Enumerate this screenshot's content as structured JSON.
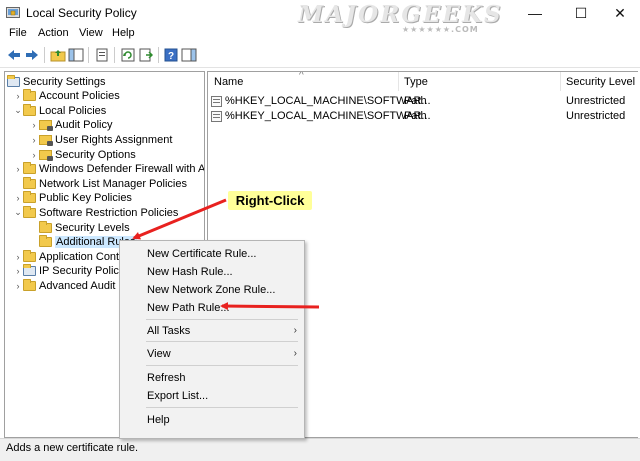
{
  "window": {
    "title": "Local Security Policy",
    "controls": {
      "minimize": "—",
      "maximize": "☐",
      "close": "✕"
    }
  },
  "watermark": {
    "brand": "MAJORGEEKS",
    "sub": "★★★★★★.COM"
  },
  "menu": [
    "File",
    "Action",
    "View",
    "Help"
  ],
  "toolbar": {
    "icons": [
      "back-arrow-icon",
      "forward-arrow-icon",
      "up-folder-icon",
      "show-hide-tree-icon",
      "properties-icon",
      "refresh-icon",
      "export-list-icon",
      "help-icon",
      "show-action-pane-icon"
    ]
  },
  "tree": [
    {
      "label": "Security Settings",
      "indent": 0,
      "chevron": "",
      "icon": "security-settings-icon"
    },
    {
      "label": "Account Policies",
      "indent": 1,
      "chevron": "›",
      "icon": "folder-icon"
    },
    {
      "label": "Local Policies",
      "indent": 1,
      "chevron": "⌄",
      "icon": "folder-icon"
    },
    {
      "label": "Audit Policy",
      "indent": 2,
      "chevron": "›",
      "icon": "lock-folder-icon"
    },
    {
      "label": "User Rights Assignment",
      "indent": 2,
      "chevron": "›",
      "icon": "lock-folder-icon"
    },
    {
      "label": "Security Options",
      "indent": 2,
      "chevron": "›",
      "icon": "lock-folder-icon"
    },
    {
      "label": "Windows Defender Firewall with Adva",
      "indent": 1,
      "chevron": "›",
      "icon": "folder-icon"
    },
    {
      "label": "Network List Manager Policies",
      "indent": 1,
      "chevron": "",
      "icon": "folder-icon"
    },
    {
      "label": "Public Key Policies",
      "indent": 1,
      "chevron": "›",
      "icon": "folder-icon"
    },
    {
      "label": "Software Restriction Policies",
      "indent": 1,
      "chevron": "⌄",
      "icon": "folder-icon"
    },
    {
      "label": "Security Levels",
      "indent": 2,
      "chevron": "",
      "icon": "folder-icon"
    },
    {
      "label": "Additional Rules",
      "indent": 2,
      "chevron": "",
      "icon": "folder-icon",
      "selected": true
    },
    {
      "label": "Application Contro",
      "indent": 1,
      "chevron": "›",
      "icon": "folder-icon"
    },
    {
      "label": "IP Security Policie",
      "indent": 1,
      "chevron": "›",
      "icon": "ip-security-icon"
    },
    {
      "label": "Advanced Audit P",
      "indent": 1,
      "chevron": "›",
      "icon": "folder-icon"
    }
  ],
  "list": {
    "columns": [
      "Name",
      "Type",
      "Security Level"
    ],
    "sort_indicator": "^",
    "rows": [
      {
        "name": "%HKEY_LOCAL_MACHINE\\SOFTWAR...",
        "type": "Path",
        "level": "Unrestricted"
      },
      {
        "name": "%HKEY_LOCAL_MACHINE\\SOFTWAR...",
        "type": "Path",
        "level": "Unrestricted"
      }
    ]
  },
  "context_menu": {
    "items": [
      {
        "label": "New Certificate Rule...",
        "submenu": false
      },
      {
        "label": "New Hash Rule...",
        "submenu": false
      },
      {
        "label": "New Network Zone Rule...",
        "submenu": false
      },
      {
        "label": "New Path Rule...",
        "submenu": false
      },
      {
        "label": "All Tasks",
        "submenu": true
      },
      {
        "label": "View",
        "submenu": true
      },
      {
        "label": "Refresh",
        "submenu": false
      },
      {
        "label": "Export List...",
        "submenu": false
      },
      {
        "label": "Help",
        "submenu": false
      }
    ],
    "submenu_arrow": "›"
  },
  "annotation": {
    "callout": "Right-Click",
    "arrow_color": "#e8211f",
    "callout_bg": "#ffff99"
  },
  "status": {
    "text": "Adds a new certificate rule."
  }
}
